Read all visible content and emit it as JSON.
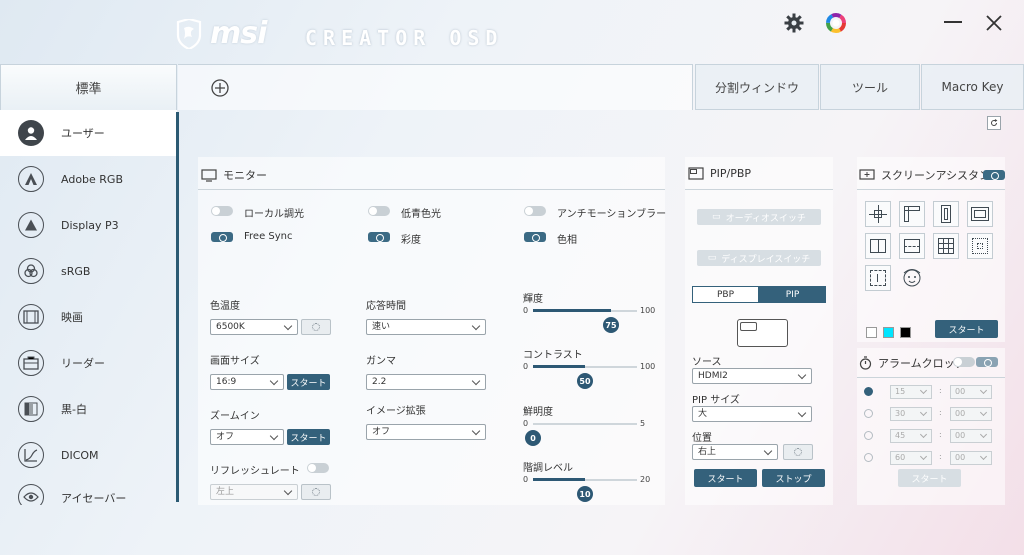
{
  "header": {
    "brand": "msi",
    "product": "CREATOR OSD"
  },
  "tabs": {
    "standard": "標準",
    "split": "分割ウィンドウ",
    "tools": "ツール",
    "macro": "Macro Key"
  },
  "sidebar": {
    "items": [
      {
        "label": "ユーザー",
        "icon": "user-icon"
      },
      {
        "label": "Adobe RGB",
        "icon": "adobe-rgb-icon"
      },
      {
        "label": "Display P3",
        "icon": "display-p3-icon"
      },
      {
        "label": "sRGB",
        "icon": "srgb-icon"
      },
      {
        "label": "映画",
        "icon": "movie-icon"
      },
      {
        "label": "リーダー",
        "icon": "reader-icon"
      },
      {
        "label": "黒-白",
        "icon": "black-white-icon"
      },
      {
        "label": "DICOM",
        "icon": "dicom-icon"
      },
      {
        "label": "アイセーバー",
        "icon": "eye-saver-icon"
      }
    ]
  },
  "monitor": {
    "title": "モニター",
    "toggles": [
      "ローカル調光",
      "低青色光",
      "アンチモーションブラー"
    ],
    "chips": [
      "Free Sync",
      "彩度",
      "色相"
    ],
    "color_temp": {
      "label": "色温度",
      "value": "6500K"
    },
    "screen_size": {
      "label": "画面サイズ",
      "value": "16:9",
      "button": "スタート"
    },
    "zoom_in": {
      "label": "ズームイン",
      "value": "オフ",
      "button": "スタート"
    },
    "refresh": {
      "label": "リフレッシュレート",
      "value": "左上"
    },
    "response": {
      "label": "応答時間",
      "value": "速い"
    },
    "gamma": {
      "label": "ガンマ",
      "value": "2.2"
    },
    "image_enhance": {
      "label": "イメージ拡張",
      "value": "オフ"
    },
    "sliders": [
      {
        "label": "輝度",
        "min": "0",
        "max": "100",
        "value": 75
      },
      {
        "label": "コントラスト",
        "min": "0",
        "max": "100",
        "value": 50
      },
      {
        "label": "鮮明度",
        "min": "0",
        "max": "5",
        "value": 0
      },
      {
        "label": "階調レベル",
        "min": "0",
        "max": "20",
        "value": 10
      }
    ]
  },
  "pip": {
    "title": "PIP/PBP",
    "audio_switch": "オーディオスイッチ",
    "display_switch": "ディスプレイスイッチ",
    "pbp": "PBP",
    "pip": "PIP",
    "source": {
      "label": "ソース",
      "value": "HDMI2"
    },
    "pip_size": {
      "label": "PIP サイズ",
      "value": "大"
    },
    "position": {
      "label": "位置",
      "value": "右上"
    },
    "start": "スタート",
    "stop": "ストップ"
  },
  "assist": {
    "title": "スクリーンアシスタンス",
    "start": "スタート",
    "colors": [
      "#ffffff",
      "#00e5ff",
      "#000000"
    ]
  },
  "alarm": {
    "title": "アラームクロック",
    "rows": [
      {
        "min": "15",
        "sec": "00"
      },
      {
        "min": "30",
        "sec": "00"
      },
      {
        "min": "45",
        "sec": "00"
      },
      {
        "min": "60",
        "sec": "00"
      }
    ],
    "sep": ":",
    "start": "スタート"
  }
}
